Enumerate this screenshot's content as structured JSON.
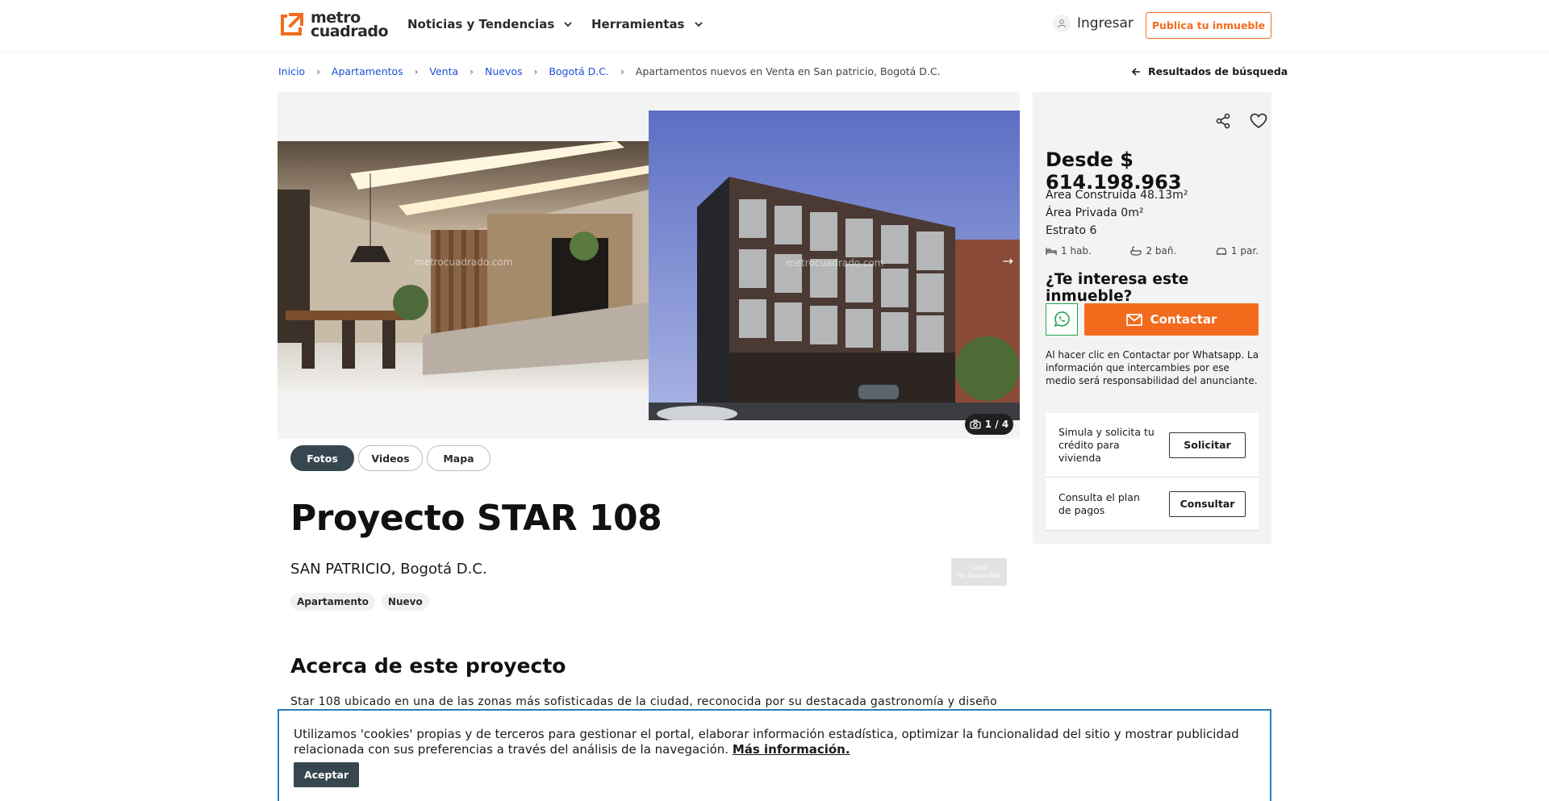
{
  "header": {
    "logo_line1": "metro",
    "logo_line2": "cuadrado",
    "nav": [
      {
        "label": "Noticias y Tendencias"
      },
      {
        "label": "Herramientas"
      }
    ],
    "login_label": "Ingresar",
    "publish_label": "Publica tu inmueble",
    "accent_color": "#f26b1d"
  },
  "breadcrumb": {
    "items": [
      "Inicio",
      "Apartamentos",
      "Venta",
      "Nuevos",
      "Bogotá D.C."
    ],
    "current": "Apartamentos nuevos en Venta en San patricio, Bogotá D.C.",
    "back_label": "Resultados de búsqueda"
  },
  "gallery": {
    "watermark": "metrocuadrado.com",
    "counter": "1 / 4",
    "tabs": [
      "Fotos",
      "Videos",
      "Mapa"
    ],
    "active_tab": "Fotos"
  },
  "listing": {
    "title": "Proyecto STAR 108",
    "location": "SAN PATRICIO, Bogotá D.C.",
    "logo_placeholder_line1": "Logo",
    "logo_placeholder_line2": "no disponible",
    "tags": [
      "Apartamento",
      "Nuevo"
    ],
    "about_title": "Acerca de este proyecto",
    "description": "Star 108 ubicado en una de las zonas más sofisticadas de la ciudad, reconocida por su destacada gastronomía y diseño"
  },
  "panel": {
    "price": "Desde $ 614.198.963",
    "area_built": "Área Construida 48.13m²",
    "area_private": "Área Privada 0m²",
    "estrato": "Estrato 6",
    "rooms": "1 hab.",
    "baths": "2 bañ.",
    "parking": "1 par.",
    "interest_title": "¿Te interesa este inmueble?",
    "contact_label": "Contactar",
    "disclaimer": "Al hacer clic en Contactar por Whatsapp. La información que intercambies por ese medio será responsabilidad del anunciante.",
    "credit_label": "Simula y solicita tu crédito para vivienda",
    "credit_button": "Solicitar",
    "plan_label": "Consulta el plan de pagos",
    "plan_button": "Consultar"
  },
  "cookie": {
    "text": "Utilizamos 'cookies' propias y de terceros para gestionar el portal, elaborar información estadística, optimizar la funcionalidad del sitio y mostrar publicidad relacionada con sus preferencias a través del análisis de la navegación.",
    "more_label": "Más información.",
    "accept_label": "Aceptar"
  }
}
